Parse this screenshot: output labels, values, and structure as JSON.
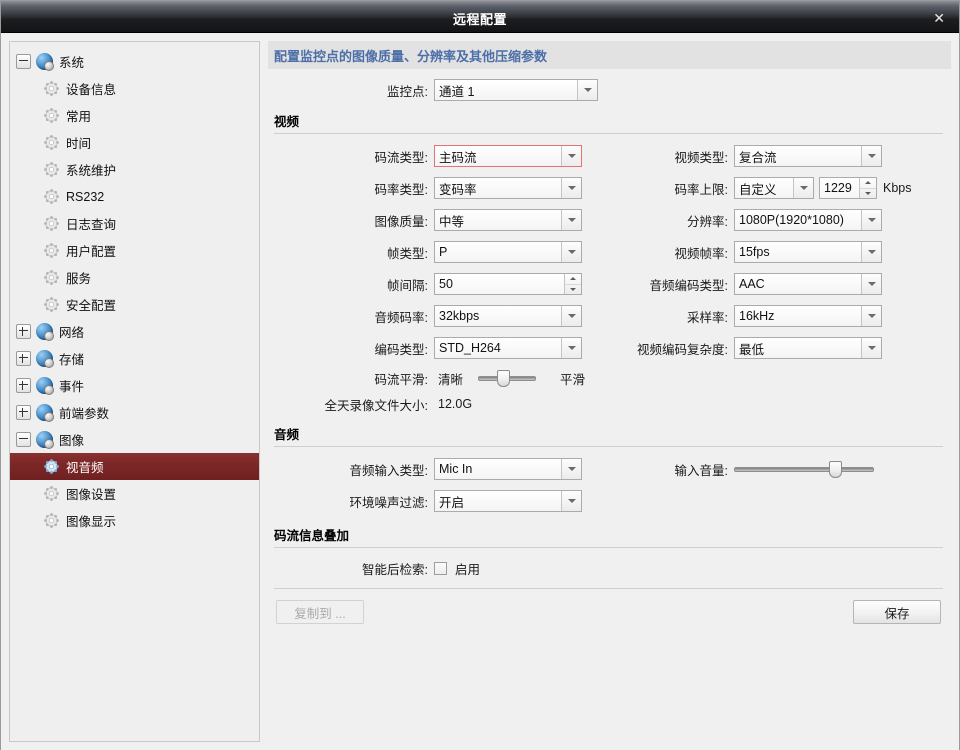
{
  "window": {
    "title": "远程配置",
    "close_label": "✕"
  },
  "sidebar": {
    "nodes": [
      {
        "label": "系统",
        "level": 0,
        "icon": "globe-icon",
        "expander": "minus",
        "selected": false
      },
      {
        "label": "设备信息",
        "level": 1,
        "icon": "gear-icon",
        "expander": "none",
        "selected": false
      },
      {
        "label": "常用",
        "level": 1,
        "icon": "gear-icon",
        "expander": "none",
        "selected": false
      },
      {
        "label": "时间",
        "level": 1,
        "icon": "gear-icon",
        "expander": "none",
        "selected": false
      },
      {
        "label": "系统维护",
        "level": 1,
        "icon": "gear-icon",
        "expander": "none",
        "selected": false
      },
      {
        "label": "RS232",
        "level": 1,
        "icon": "gear-icon",
        "expander": "none",
        "selected": false
      },
      {
        "label": "日志查询",
        "level": 1,
        "icon": "gear-icon",
        "expander": "none",
        "selected": false
      },
      {
        "label": "用户配置",
        "level": 1,
        "icon": "gear-icon",
        "expander": "none",
        "selected": false
      },
      {
        "label": "服务",
        "level": 1,
        "icon": "gear-icon",
        "expander": "none",
        "selected": false
      },
      {
        "label": "安全配置",
        "level": 1,
        "icon": "gear-icon",
        "expander": "none",
        "selected": false
      },
      {
        "label": "网络",
        "level": 0,
        "icon": "globe-icon",
        "expander": "plus",
        "selected": false
      },
      {
        "label": "存储",
        "level": 0,
        "icon": "globe-icon",
        "expander": "plus",
        "selected": false
      },
      {
        "label": "事件",
        "level": 0,
        "icon": "globe-icon",
        "expander": "plus",
        "selected": false
      },
      {
        "label": "前端参数",
        "level": 0,
        "icon": "globe-icon",
        "expander": "plus",
        "selected": false
      },
      {
        "label": "图像",
        "level": 0,
        "icon": "globe-icon",
        "expander": "minus",
        "selected": false
      },
      {
        "label": "视音频",
        "level": 1,
        "icon": "gear-icon",
        "expander": "none",
        "selected": true
      },
      {
        "label": "图像设置",
        "level": 1,
        "icon": "gear-icon",
        "expander": "none",
        "selected": false
      },
      {
        "label": "图像显示",
        "level": 1,
        "icon": "gear-icon",
        "expander": "none",
        "selected": false
      }
    ]
  },
  "main": {
    "banner": "配置监控点的图像质量、分辨率及其他压缩参数",
    "channel": {
      "label": "监控点:",
      "value": "通道 1"
    },
    "video": {
      "title": "视频",
      "left": {
        "stream_type": {
          "label": "码流类型:",
          "value": "主码流"
        },
        "bitrate_type": {
          "label": "码率类型:",
          "value": "变码率"
        },
        "image_quality": {
          "label": "图像质量:",
          "value": "中等"
        },
        "frame_type": {
          "label": "帧类型:",
          "value": "P"
        },
        "frame_interval": {
          "label": "帧间隔:",
          "value": "50"
        },
        "audio_bitrate": {
          "label": "音频码率:",
          "value": "32kbps"
        },
        "encode_type": {
          "label": "编码类型:",
          "value": "STD_H264"
        }
      },
      "right": {
        "video_type": {
          "label": "视频类型:",
          "value": "复合流"
        },
        "max_bitrate": {
          "label": "码率上限:",
          "value": "自定义",
          "number": "1229",
          "unit": "Kbps"
        },
        "resolution": {
          "label": "分辨率:",
          "value": "1080P(1920*1080)"
        },
        "frame_rate": {
          "label": "视频帧率:",
          "value": "15fps"
        },
        "audio_encode": {
          "label": "音频编码类型:",
          "value": "AAC"
        },
        "sample_rate": {
          "label": "采样率:",
          "value": "16kHz"
        },
        "video_complexity": {
          "label": "视频编码复杂度:",
          "value": "最低"
        }
      },
      "smooth": {
        "label": "码流平滑:",
        "min_label": "清晰",
        "max_label": "平滑",
        "percent": 42
      },
      "file_size": {
        "label": "全天录像文件大小:",
        "value": "12.0G"
      }
    },
    "audio": {
      "title": "音频",
      "input_type": {
        "label": "音频输入类型:",
        "value": "Mic In"
      },
      "noise_filter": {
        "label": "环境噪声过滤:",
        "value": "开启"
      },
      "input_volume": {
        "label": "输入音量:",
        "percent": 75
      }
    },
    "overlay": {
      "title": "码流信息叠加",
      "smart_search": {
        "label": "智能后检索:",
        "checkbox_label": "启用",
        "checked": false
      }
    },
    "footer": {
      "copy_to": "复制到 ...",
      "save": "保存"
    }
  },
  "colors": {
    "accent_banner_text": "#4c6fa8",
    "selection_red": "#7e2828",
    "focus_border": "#e57373"
  }
}
